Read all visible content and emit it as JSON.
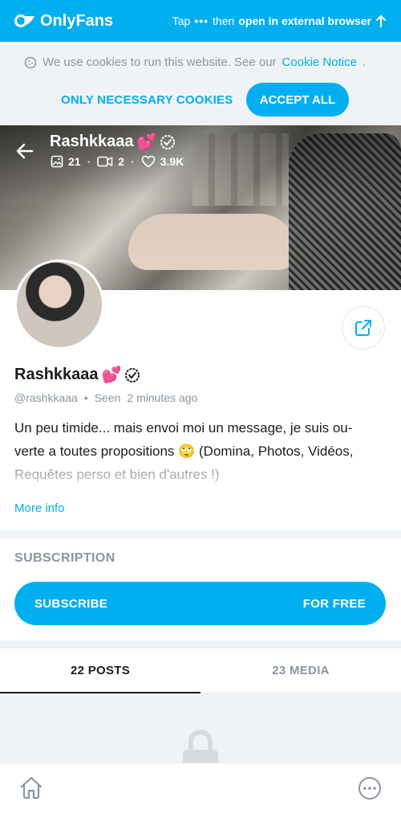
{
  "header": {
    "brand": "OnlyFans",
    "tap_prefix": "Tap",
    "tap_dots": "•••",
    "tap_then": "then",
    "tap_action": "open in external browser"
  },
  "cookie": {
    "message": "We use cookies to run this website. See our",
    "link": "Cookie Notice",
    "period": ".",
    "necessary_label": "ONLY NECESSARY COOKIES",
    "accept_label": "ACCEPT ALL"
  },
  "cover": {
    "name": "Rashkkaaa",
    "emoji": "💕",
    "photos": "21",
    "videos": "2",
    "likes": "3.9K",
    "sep": "·"
  },
  "profile": {
    "name": "Rashkkaaa",
    "emoji": "💕",
    "handle": "@rashkkaaa",
    "dot": "•",
    "seen_label": "Seen",
    "seen_time": "2 minutes ago",
    "bio_line1": "Un peu timide... mais envoi moi un message, je suis ou-",
    "bio_line2": "verte a toutes propositions 🙄 (Domina, Photos, Vidéos,",
    "bio_line3": "Requêtes perso et bien d'autres !)",
    "more_info": "More info"
  },
  "subscription": {
    "title": "SUBSCRIPTION",
    "button_label": "SUBSCRIBE",
    "button_price": "FOR FREE"
  },
  "tabs": [
    {
      "label": "22 POSTS"
    },
    {
      "label": "23 MEDIA"
    }
  ],
  "colors": {
    "accent": "#00aff0",
    "muted": "#8a96a3",
    "panel": "#f0f3f5"
  }
}
